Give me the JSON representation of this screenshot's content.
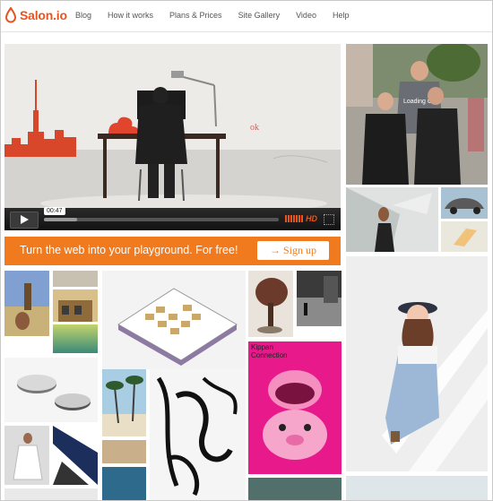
{
  "header": {
    "logo_text": "Salon.io",
    "nav": [
      "Blog",
      "How it works",
      "Plans & Prices",
      "Site Gallery",
      "Video",
      "Help"
    ]
  },
  "video": {
    "current_time": "00:47",
    "hd_label": "HD",
    "progress": 0.14,
    "whiteboard_scribble": "ok"
  },
  "photo_crowd": {
    "shirt_text": "Loading Gay"
  },
  "banner": {
    "tagline": "Turn the web into your playground. For free!",
    "signup_label": "→ Sign up"
  },
  "poster": {
    "title_line1": "Kippan",
    "title_line2": "Connection"
  },
  "colors": {
    "brand_orange": "#f07a1d",
    "poster_pink": "#e8198b"
  }
}
